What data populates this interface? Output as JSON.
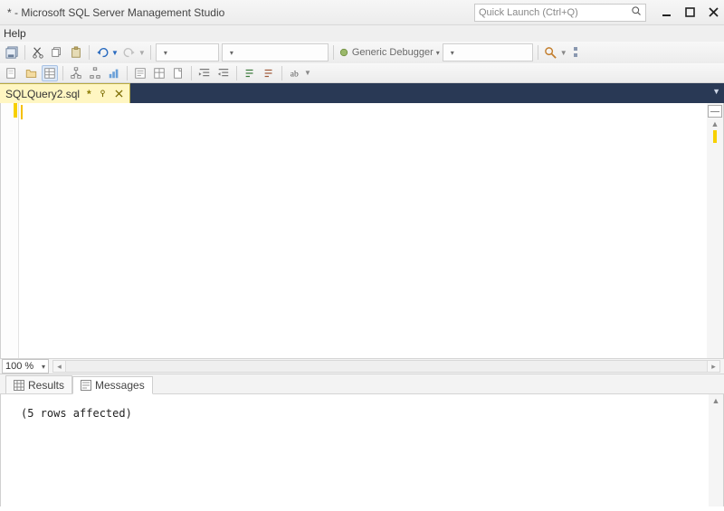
{
  "titlebar": {
    "title": "* - Microsoft SQL Server Management Studio"
  },
  "quicklaunch": {
    "placeholder": "Quick Launch (Ctrl+Q)"
  },
  "menubar": {
    "help": "Help"
  },
  "toolbar": {
    "debugger_label": "Generic Debugger"
  },
  "doctab": {
    "name": "SQLQuery2.sql",
    "dirty_marker": "*"
  },
  "zoom": {
    "value": "100 %"
  },
  "result_tabs": {
    "results": "Results",
    "messages": "Messages"
  },
  "messages_panel": {
    "text": "(5 rows affected)"
  }
}
